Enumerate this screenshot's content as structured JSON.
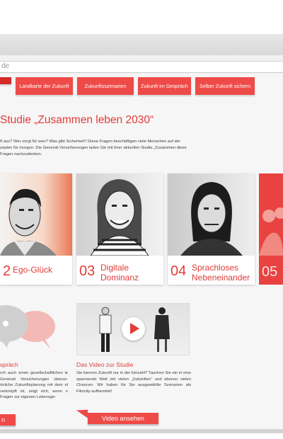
{
  "browser": {
    "url": "de"
  },
  "nav": {
    "tabs": [
      {
        "label": "Landkarte der Zukunft"
      },
      {
        "label": "Zukunftsszenarien"
      },
      {
        "label": "Zukunft im Gespräch"
      },
      {
        "label": "Selber Zukunft sichern"
      }
    ]
  },
  "main": {
    "title": "Studie „Zusammen leben 2030“",
    "intro": "ft aus? Wer sorgt für wen? Was gibt Sicherheit? Diese Fragen beschäftigen viele Menschen auf der zepten für morgen. Die Generali Versicherungen laden Sie mit ihrer aktuellen Studie „Zusammen diese Fragen nachzudenken."
  },
  "scenarios": [
    {
      "num": "2",
      "label": "Ego-Glück"
    },
    {
      "num": "03",
      "label": "Digitale Dominanz"
    },
    {
      "num": "04",
      "label": "Sprachloses Nebeneinander"
    },
    {
      "num": "05",
      "label": ""
    }
  ],
  "gespraech": {
    "title": "spräch",
    "text": "rch auch einen gesellschaftlichen ie Generali Versicherungen überze- önliche Zukunftsplanung mit dem el verknüpft ist, zeigt sich, wenn n Fragen zur eigenen Lebensge-",
    "button": "n"
  },
  "video": {
    "title": "Das Video zur Studie",
    "text": "Sie kennen Zukunft nur in der Einzahl? Tauchen Sie ein in eine spannende Welt mit vielen „Zukünften“ und ebenso vielen Chancen. Wir haben für Sie ausgewählte Szenarien als Filmclip aufbereitet!",
    "button": "Video ansehen"
  },
  "colors": {
    "accent": "#e03c38",
    "tab": "#ee4b48"
  }
}
